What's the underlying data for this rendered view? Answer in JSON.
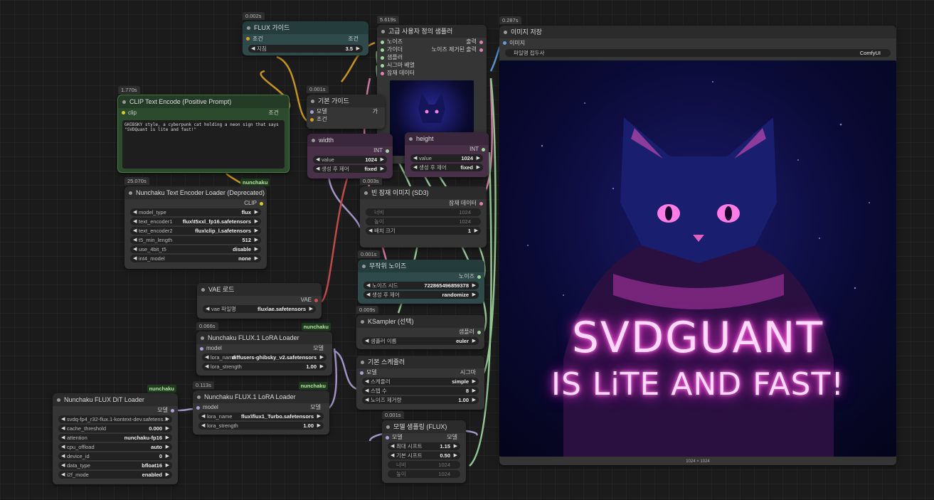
{
  "nodes": {
    "flux_guidance": {
      "timer": "0.002s",
      "title": "FLUX 가이드",
      "in_label": "조건",
      "out_label": "조건",
      "widget_label": "지침",
      "widget_value": "3.5"
    },
    "custom_sampler": {
      "timer": "5.619s",
      "title": "고급 사용자 정의 샘플러",
      "inputs": [
        "노이즈",
        "가이더",
        "샘플러",
        "시그마 배열",
        "잠재 데이터"
      ],
      "outputs": [
        "출력",
        "노이즈 제거된 출력"
      ]
    },
    "save_image": {
      "timer": "0.287s",
      "title": "이미지 저장",
      "in_label": "이미지",
      "widget_label": "파일명 접두사",
      "widget_value": "ComfyUI",
      "image_size": "1024 × 1024",
      "image_text": [
        "SVDGUANT",
        "IS LiTE AND FAST!"
      ]
    },
    "clip_encode": {
      "timer": "1.770s",
      "title": "CLIP Text Encode (Positive Prompt)",
      "in_label": "clip",
      "out_label": "조건",
      "text": "GHIBSKY style, a cyberpunk cat holding a neon sign that says \"SVDQuant is lite and fast!\"",
      "badge": "nunchaku"
    },
    "basic_guider": {
      "timer": "0.001s",
      "title": "기본 가이드",
      "inputs": [
        "모델",
        "조건"
      ],
      "out_label": "가"
    },
    "width": {
      "title": "width",
      "out_label": "INT",
      "widgets": [
        {
          "label": "value",
          "value": "1024"
        },
        {
          "label": "생성 후 제어",
          "value": "fixed"
        }
      ]
    },
    "height": {
      "title": "height",
      "out_label": "INT",
      "widgets": [
        {
          "label": "value",
          "value": "1024"
        },
        {
          "label": "생성 후 제어",
          "value": "fixed"
        }
      ]
    },
    "text_encoder_loader": {
      "timer": "25.070s",
      "title": "Nunchaku Text Encoder Loader (Deprecated)",
      "out_label": "CLIP",
      "widgets": [
        {
          "label": "model_type",
          "value": "flux"
        },
        {
          "label": "text_encoder1",
          "value": "flux\\t5xxl_fp16.safetensors"
        },
        {
          "label": "text_encoder2",
          "value": "flux\\clip_l.safetensors"
        },
        {
          "label": "t5_min_length",
          "value": "512"
        },
        {
          "label": "use_4bit_t5",
          "value": "disable"
        },
        {
          "label": "int4_model",
          "value": "none"
        }
      ]
    },
    "empty_latent": {
      "timer": "0.003s",
      "title": "빈 잠재 이미지 (SD3)",
      "out_label": "잠재 데이터",
      "dim_rows": [
        {
          "label": "너비",
          "value": "1024"
        },
        {
          "label": "높이",
          "value": "1024"
        }
      ],
      "widget_label": "배치 크기",
      "widget_value": "1"
    },
    "random_noise": {
      "timer": "0.001s",
      "title": "무작위 노이즈",
      "out_label": "노이즈",
      "widgets": [
        {
          "label": "노이즈 시드",
          "value": "722865496859378"
        },
        {
          "label": "생성 후 제어",
          "value": "randomize"
        }
      ]
    },
    "vae_loader": {
      "title": "VAE 로드",
      "out_label": "VAE",
      "widget_label": "vae 파일명",
      "widget_value": "flux\\ae.safetensors"
    },
    "ksampler_select": {
      "timer": "0.009s",
      "title": "KSampler (선택)",
      "out_label": "샘플러",
      "widget_label": "샘플러 이름",
      "widget_value": "euler"
    },
    "lora1": {
      "timer": "0.066s",
      "badge": "nunchaku",
      "title": "Nunchaku FLUX.1 LoRA Loader",
      "in_label": "model",
      "out_label": "모델",
      "widgets": [
        {
          "label": "lora_name",
          "value": "diffusers-ghibsky_v2.safetensors"
        },
        {
          "label": "lora_strength",
          "value": "1.00"
        }
      ]
    },
    "basic_scheduler": {
      "title": "기본 스케줄러",
      "in_label": "모델",
      "out_label": "시그마",
      "widgets": [
        {
          "label": "스케줄러",
          "value": "simple"
        },
        {
          "label": "스텝 수",
          "value": "8"
        },
        {
          "label": "노이즈 제거량",
          "value": "1.00"
        }
      ]
    },
    "lora2": {
      "timer": "0.113s",
      "badge": "nunchaku",
      "title": "Nunchaku FLUX.1 LoRA Loader",
      "in_label": "model",
      "out_label": "모델",
      "widgets": [
        {
          "label": "lora_name",
          "value": "flux\\flux1_Turbo.safetensors"
        },
        {
          "label": "lora_strength",
          "value": "1.00"
        }
      ]
    },
    "dit_loader": {
      "badge": "nunchaku",
      "title": "Nunchaku FLUX DiT Loader",
      "out_label": "모델",
      "widgets": [
        {
          "label": "svdq-fp4_r32-flux.1-kontext-dev.safetens…",
          "value": ""
        },
        {
          "label": "cache_threshold",
          "value": "0.000"
        },
        {
          "label": "attention",
          "value": "nunchaku-fp16"
        },
        {
          "label": "cpu_offload",
          "value": "auto"
        },
        {
          "label": "device_id",
          "value": "0"
        },
        {
          "label": "data_type",
          "value": "bfloat16"
        },
        {
          "label": "i2f_mode",
          "value": "enabled"
        }
      ]
    },
    "model_sampling": {
      "timer": "0.001s",
      "title": "모델 샘플링 (FLUX)",
      "in_label": "모델",
      "out_label": "모델",
      "widgets": [
        {
          "label": "최대 시프트",
          "value": "1.15"
        },
        {
          "label": "기본 시프트",
          "value": "0.50"
        }
      ],
      "dim_rows": [
        {
          "label": "너비",
          "value": "1024"
        },
        {
          "label": "높이",
          "value": "1024"
        }
      ]
    }
  },
  "colors": {
    "wire_yellow": "#d8a020",
    "wire_lavender": "#b0a0d8",
    "wire_green": "#a0d8a0",
    "wire_pink": "#e080b0",
    "wire_red": "#d05050",
    "wire_teal": "#60c0b0",
    "neon_pink": "#ff7be5"
  }
}
